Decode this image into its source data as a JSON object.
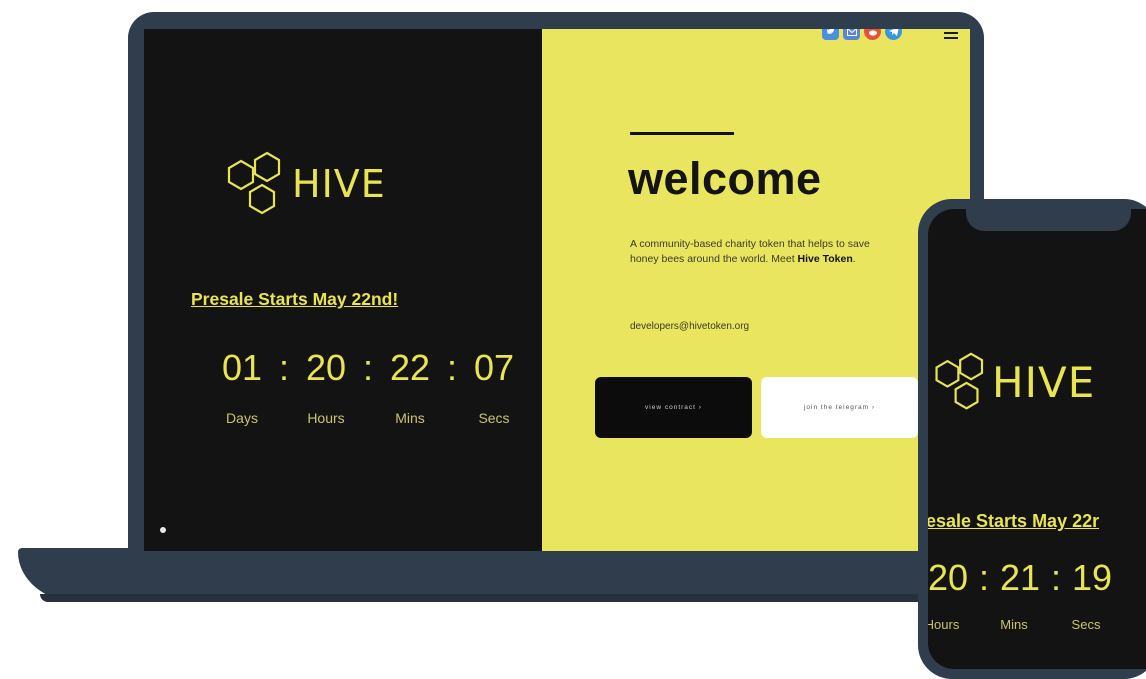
{
  "brand": {
    "logo_text": "HIVE",
    "accent": "#e8e452"
  },
  "laptop": {
    "presale_text": "Presale Starts May 22nd!",
    "countdown": {
      "days": "01",
      "hours": "20",
      "mins": "22",
      "secs": "07",
      "separator": ":"
    },
    "labels": {
      "days": "Days",
      "hours": "Hours",
      "mins": "Mins",
      "secs": "Secs"
    }
  },
  "welcome": {
    "title": "welcome",
    "description_pre": "A community-based charity token that helps to save honey bees around the world. Meet ",
    "description_bold": "Hive Token",
    "description_post": ".",
    "email": "developers@hivetoken.org",
    "buttons": {
      "view_contract": "view contract ›",
      "join_telegram": "join the telegram ›"
    },
    "social_icons": [
      {
        "name": "twitter-icon",
        "color": "#4a8fe0"
      },
      {
        "name": "mail-icon",
        "color": "#5a86d8"
      },
      {
        "name": "reddit-icon",
        "color": "#e8503a"
      },
      {
        "name": "telegram-icon",
        "color": "#3d95d9"
      }
    ]
  },
  "phone": {
    "logo_text": "HIVE",
    "presale_text": "esale Starts May 22r",
    "countdown": {
      "hours": "20",
      "mins": "21",
      "secs": "19",
      "separator": ":"
    },
    "labels": {
      "hours": "Hours",
      "mins": "Mins",
      "secs": "Secs"
    }
  }
}
